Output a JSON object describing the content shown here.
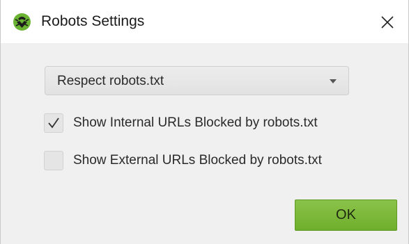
{
  "window": {
    "title": "Robots Settings",
    "app_icon": "spider-logo-icon",
    "close_icon": "close-icon"
  },
  "dropdown": {
    "selected": "Respect robots.txt",
    "arrow_icon": "chevron-down-icon"
  },
  "checkboxes": [
    {
      "label": "Show Internal URLs Blocked by robots.txt",
      "checked": true
    },
    {
      "label": "Show External URLs Blocked by robots.txt",
      "checked": false
    }
  ],
  "buttons": {
    "ok_label": "OK"
  },
  "colors": {
    "accent": "#7ab83a",
    "content_bg": "#f0f0f0",
    "logo_green": "#6bb332"
  }
}
